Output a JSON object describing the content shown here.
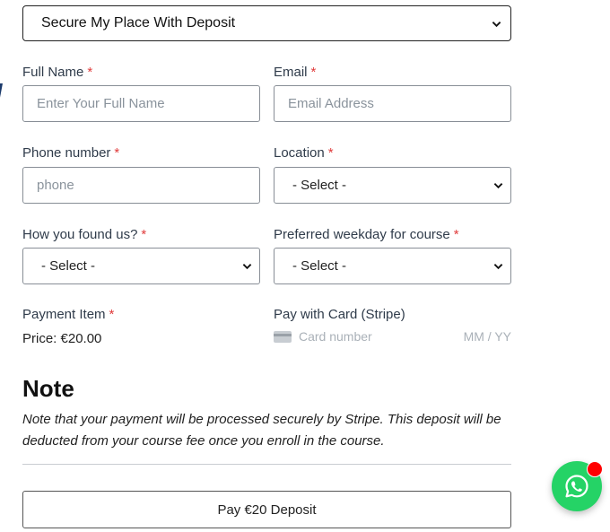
{
  "deposit_select": {
    "value": "Secure My Place With Deposit"
  },
  "fields": {
    "full_name": {
      "label": "Full Name",
      "required": "*",
      "placeholder": "Enter Your Full Name"
    },
    "email": {
      "label": "Email",
      "required": "*",
      "placeholder": "Email Address"
    },
    "phone": {
      "label": "Phone number",
      "required": "*",
      "placeholder": "phone"
    },
    "location": {
      "label": "Location",
      "required": "*",
      "value": "- Select -"
    },
    "found_us": {
      "label": "How you found us?",
      "required": "*",
      "value": "- Select -"
    },
    "weekday": {
      "label": "Preferred weekday for course",
      "required": "*",
      "value": "- Select -"
    }
  },
  "payment_item": {
    "label": "Payment Item",
    "required": "*",
    "price": "Price: €20.00"
  },
  "stripe": {
    "label": "Pay with Card (Stripe)",
    "card_placeholder": "Card number",
    "expiry_placeholder": "MM / YY"
  },
  "note": {
    "title": "Note",
    "text": "Note that your payment will be processed securely by Stripe. This deposit will be deducted from your course fee once you enroll in the course."
  },
  "pay_button": {
    "label": "Pay €20 Deposit"
  },
  "icons": {
    "whatsapp": "whatsapp-icon",
    "chevron": "chevron-down-icon",
    "card": "credit-card-icon"
  },
  "colors": {
    "required": "#e03b3b",
    "whatsapp": "#25d366",
    "notification": "#ff0000"
  }
}
